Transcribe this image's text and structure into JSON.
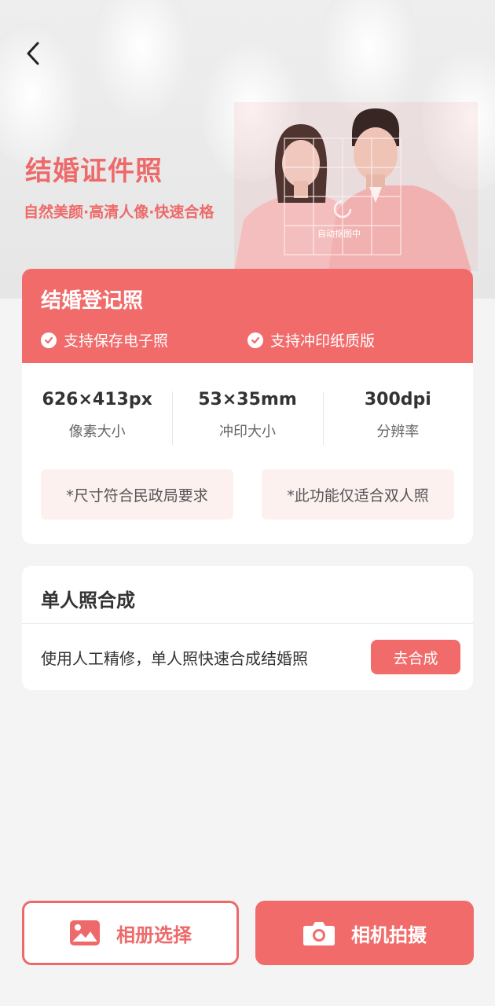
{
  "hero": {
    "title": "结婚证件照",
    "subtitle": "自然美颜·高清人像·快速合格",
    "scan_text": "自动抠图中"
  },
  "card": {
    "title": "结婚登记照",
    "features": [
      "支持保存电子照",
      "支持冲印纸质版"
    ],
    "specs": [
      {
        "value": "626×413px",
        "label": "像素大小"
      },
      {
        "value": "53×35mm",
        "label": "冲印大小"
      },
      {
        "value": "300dpi",
        "label": "分辨率"
      }
    ],
    "notes": [
      "*尺寸符合民政局要求",
      "*此功能仅适合双人照"
    ]
  },
  "single": {
    "title": "单人照合成",
    "desc": "使用人工精修，单人照快速合成结婚照",
    "button": "去合成"
  },
  "bottom": {
    "album": "相册选择",
    "camera": "相机拍摄"
  },
  "colors": {
    "accent": "#f26b6b",
    "accent_text": "#ee6a6a",
    "note_bg": "#fdf1f0",
    "page_bg": "#f4f4f4"
  },
  "icons": [
    "back-arrow-icon",
    "check-circle-icon",
    "image-icon",
    "camera-icon"
  ]
}
